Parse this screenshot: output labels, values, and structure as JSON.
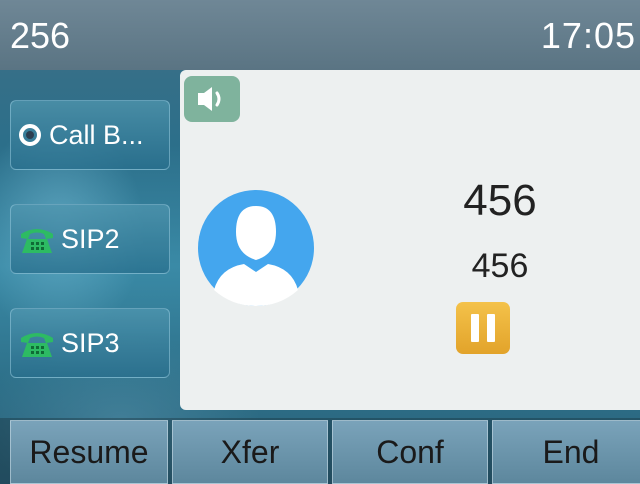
{
  "status_bar": {
    "account": "256",
    "time": "17:05"
  },
  "line_keys": [
    {
      "label": "Call B...",
      "icon": "call-back-icon"
    },
    {
      "label": "SIP2",
      "icon": "phone-icon"
    },
    {
      "label": "SIP3",
      "icon": "phone-icon"
    }
  ],
  "call": {
    "name": "456",
    "number": "456",
    "audio_mode_icon": "speaker-icon",
    "state_icon": "hold-icon"
  },
  "softkeys": [
    {
      "label": "Resume"
    },
    {
      "label": "Xfer"
    },
    {
      "label": "Conf"
    },
    {
      "label": "End"
    }
  ],
  "colors": {
    "speaker_badge": "#7fb39d",
    "hold_badge": "#e2a32a",
    "avatar": "#44a6ee",
    "phone_icon": "#2dbb63"
  }
}
